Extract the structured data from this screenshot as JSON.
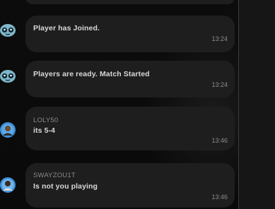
{
  "messages": [
    {
      "username": "",
      "text": "Player has Joined.",
      "time": "13:24",
      "avatar": "alien-bot"
    },
    {
      "username": "",
      "text": "Players are ready. Match Started",
      "time": "13:24",
      "avatar": "alien-bot"
    },
    {
      "username": "LOLY50",
      "text": "its 5-4",
      "time": "13:46",
      "avatar": "user"
    },
    {
      "username": "SWAYZOU1T",
      "text": "Is not you playing",
      "time": "13:46",
      "avatar": "user"
    }
  ],
  "colors": {
    "background": "#0b0b0b",
    "bubble": "#1e1e1e",
    "alien_avatar": "#7fb6c9",
    "user_avatar_ring": "#3f8fd6"
  }
}
